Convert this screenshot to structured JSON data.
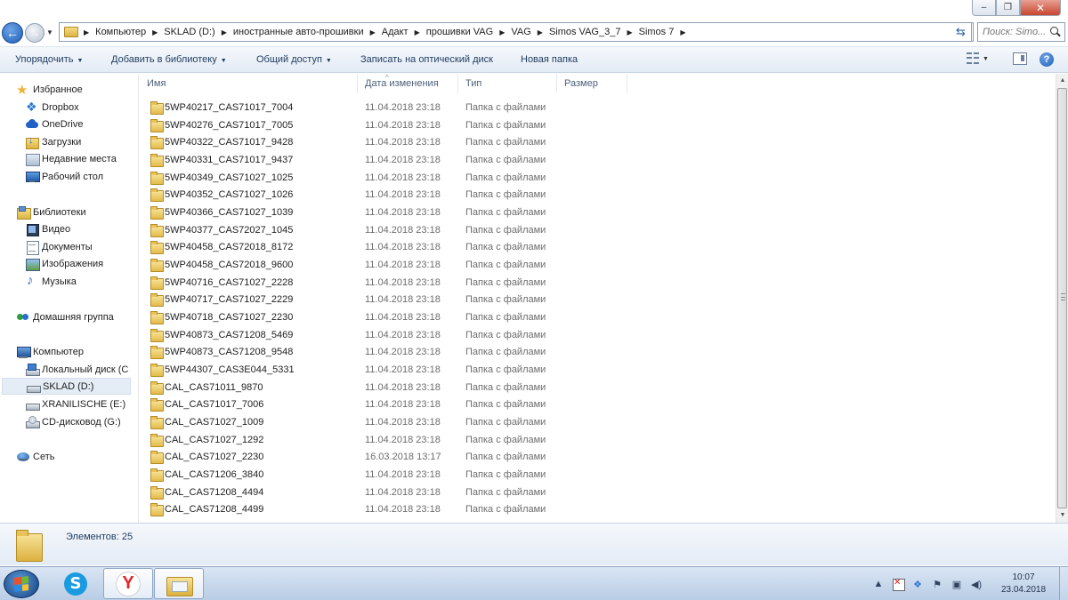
{
  "window": {
    "caption_buttons": [
      "minimize",
      "maximize",
      "close"
    ],
    "close_glyph": "✕"
  },
  "address": {
    "crumbs": [
      "Компьютер",
      "SKLAD (D:)",
      "иностранные авто-прошивки",
      "Адакт",
      "прошивки VAG",
      "VAG",
      "Simos VAG_3_7",
      "Simos 7"
    ],
    "search_placeholder": "Поиск: Simo..."
  },
  "toolbar": {
    "organize": "Упорядочить",
    "add_library": "Добавить в библиотеку",
    "share": "Общий доступ",
    "burn": "Записать на оптический диск",
    "new_folder": "Новая папка"
  },
  "sidebar": {
    "items": [
      {
        "label": "Избранное",
        "icon": "star-icon"
      },
      {
        "label": "Dropbox",
        "icon": "dropbox-icon"
      },
      {
        "label": "OneDrive",
        "icon": "onedrive-icon"
      },
      {
        "label": "Загрузки",
        "icon": "downloads-icon"
      },
      {
        "label": "Недавние места",
        "icon": "recent-places-icon"
      },
      {
        "label": "Рабочий стол",
        "icon": "desktop-icon"
      },
      {
        "label": "Библиотеки",
        "icon": "libraries-icon"
      },
      {
        "label": "Видео",
        "icon": "video-icon"
      },
      {
        "label": "Документы",
        "icon": "documents-icon"
      },
      {
        "label": "Изображения",
        "icon": "pictures-icon"
      },
      {
        "label": "Музыка",
        "icon": "music-icon"
      },
      {
        "label": "Домашняя группа",
        "icon": "homegroup-icon"
      },
      {
        "label": "Компьютер",
        "icon": "computer-icon"
      },
      {
        "label": "Локальный диск (C",
        "icon": "system-drive-icon"
      },
      {
        "label": "SKLAD (D:)",
        "icon": "drive-icon"
      },
      {
        "label": "XRANILISCHE (E:)",
        "icon": "drive-icon"
      },
      {
        "label": "CD-дисковод (G:)",
        "icon": "cd-drive-icon"
      },
      {
        "label": "Сеть",
        "icon": "network-icon"
      }
    ],
    "selected": "SKLAD (D:)"
  },
  "columns": {
    "name": "Имя",
    "date": "Дата изменения",
    "type": "Тип",
    "size": "Размер"
  },
  "files": [
    {
      "name": "5WP40217_CAS71017_7004",
      "date": "11.04.2018 23:18",
      "type": "Папка с файлами"
    },
    {
      "name": "5WP40276_CAS71017_7005",
      "date": "11.04.2018 23:18",
      "type": "Папка с файлами"
    },
    {
      "name": "5WP40322_CAS71017_9428",
      "date": "11.04.2018 23:18",
      "type": "Папка с файлами"
    },
    {
      "name": "5WP40331_CAS71017_9437",
      "date": "11.04.2018 23:18",
      "type": "Папка с файлами"
    },
    {
      "name": "5WP40349_CAS71027_1025",
      "date": "11.04.2018 23:18",
      "type": "Папка с файлами"
    },
    {
      "name": "5WP40352_CAS71027_1026",
      "date": "11.04.2018 23:18",
      "type": "Папка с файлами"
    },
    {
      "name": "5WP40366_CAS71027_1039",
      "date": "11.04.2018 23:18",
      "type": "Папка с файлами"
    },
    {
      "name": "5WP40377_CAS72027_1045",
      "date": "11.04.2018 23:18",
      "type": "Папка с файлами"
    },
    {
      "name": "5WP40458_CAS72018_8172",
      "date": "11.04.2018 23:18",
      "type": "Папка с файлами"
    },
    {
      "name": "5WP40458_CAS72018_9600",
      "date": "11.04.2018 23:18",
      "type": "Папка с файлами"
    },
    {
      "name": "5WP40716_CAS71027_2228",
      "date": "11.04.2018 23:18",
      "type": "Папка с файлами"
    },
    {
      "name": "5WP40717_CAS71027_2229",
      "date": "11.04.2018 23:18",
      "type": "Папка с файлами"
    },
    {
      "name": "5WP40718_CAS71027_2230",
      "date": "11.04.2018 23:18",
      "type": "Папка с файлами"
    },
    {
      "name": "5WP40873_CAS71208_5469",
      "date": "11.04.2018 23:18",
      "type": "Папка с файлами"
    },
    {
      "name": "5WP40873_CAS71208_9548",
      "date": "11.04.2018 23:18",
      "type": "Папка с файлами"
    },
    {
      "name": "5WP44307_CAS3E044_5331",
      "date": "11.04.2018 23:18",
      "type": "Папка с файлами"
    },
    {
      "name": "CAL_CAS71011_9870",
      "date": "11.04.2018 23:18",
      "type": "Папка с файлами"
    },
    {
      "name": "CAL_CAS71017_7006",
      "date": "11.04.2018 23:18",
      "type": "Папка с файлами"
    },
    {
      "name": "CAL_CAS71027_1009",
      "date": "11.04.2018 23:18",
      "type": "Папка с файлами"
    },
    {
      "name": "CAL_CAS71027_1292",
      "date": "11.04.2018 23:18",
      "type": "Папка с файлами"
    },
    {
      "name": "CAL_CAS71027_2230",
      "date": "16.03.2018 13:17",
      "type": "Папка с файлами"
    },
    {
      "name": "CAL_CAS71206_3840",
      "date": "11.04.2018 23:18",
      "type": "Папка с файлами"
    },
    {
      "name": "CAL_CAS71208_4494",
      "date": "11.04.2018 23:18",
      "type": "Папка с файлами"
    },
    {
      "name": "CAL_CAS71208_4499",
      "date": "11.04.2018 23:18",
      "type": "Папка с файлами"
    }
  ],
  "details": {
    "count_text": "Элементов: 25"
  },
  "taskbar": {
    "apps": [
      "skype-icon",
      "yandex-browser-icon",
      "explorer-icon"
    ],
    "skype_glyph": "S",
    "yandex_glyph": "Y"
  },
  "clock": {
    "time": "10:07",
    "date": "23.04.2018"
  },
  "colors": {
    "accent": "#1c5fb9",
    "folder": "#e3bb4a",
    "toolbar_text": "#1e3a5f",
    "selection": "#e4ecf5"
  }
}
